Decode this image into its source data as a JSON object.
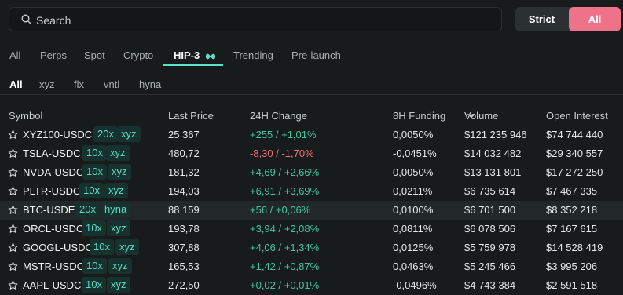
{
  "search": {
    "placeholder": "Search",
    "value": ""
  },
  "mode_toggle": {
    "strict_label": "Strict",
    "all_label": "All",
    "active_color": "#ee7388"
  },
  "category_tabs": [
    {
      "label": "All"
    },
    {
      "label": "Perps"
    },
    {
      "label": "Spot"
    },
    {
      "label": "Crypto"
    },
    {
      "label": "HIP-3",
      "active": true,
      "icon": "hyperliquid-logo-icon"
    },
    {
      "label": "Trending"
    },
    {
      "label": "Pre-launch"
    }
  ],
  "dex_tabs": [
    {
      "label": "All",
      "active": true
    },
    {
      "label": "xyz"
    },
    {
      "label": "flx"
    },
    {
      "label": "vntl"
    },
    {
      "label": "hyna"
    }
  ],
  "table": {
    "headers": {
      "symbol": "Symbol",
      "last_price": "Last Price",
      "change_24h": "24H Change",
      "funding_8h": "8H Funding",
      "volume": "Volume",
      "open_interest": "Open Interest"
    },
    "sort_icon": "chevron-down-icon",
    "rows": [
      {
        "symbol": "XYZ100-USDC",
        "leverage": "20x",
        "dex": "xyz",
        "price": "25 367",
        "change": "+255 / +1,01%",
        "funding": "0,0050%",
        "volume": "$121 235 946",
        "oi": "$74 744 440"
      },
      {
        "symbol": "TSLA-USDC",
        "leverage": "10x",
        "dex": "xyz",
        "price": "480,72",
        "change": "-8,30 / -1,70%",
        "funding": "-0,0451%",
        "volume": "$14 032 482",
        "oi": "$29 340 557"
      },
      {
        "symbol": "NVDA-USDC",
        "leverage": "10x",
        "dex": "xyz",
        "price": "181,32",
        "change": "+4,69 / +2,66%",
        "funding": "0,0050%",
        "volume": "$13 131 801",
        "oi": "$17 272 250"
      },
      {
        "symbol": "PLTR-USDC",
        "leverage": "10x",
        "dex": "xyz",
        "price": "194,03",
        "change": "+6,91 / +3,69%",
        "funding": "0,0211%",
        "volume": "$6 735 614",
        "oi": "$7 467 335"
      },
      {
        "symbol": "BTC-USDE",
        "leverage": "20x",
        "dex": "hyna",
        "price": "88 159",
        "change": "+56 / +0,06%",
        "funding": "0,0100%",
        "volume": "$6 701 500",
        "oi": "$8 352 218"
      },
      {
        "symbol": "ORCL-USDC",
        "leverage": "10x",
        "dex": "xyz",
        "price": "193,78",
        "change": "+3,94 / +2,08%",
        "funding": "0,0811%",
        "volume": "$6 078 506",
        "oi": "$7 167 615"
      },
      {
        "symbol": "GOOGL-USDC",
        "leverage": "10x",
        "dex": "xyz",
        "price": "307,88",
        "change": "+4,06 / +1,34%",
        "funding": "0,0125%",
        "volume": "$5 759 978",
        "oi": "$14 528 419"
      },
      {
        "symbol": "MSTR-USDC",
        "leverage": "10x",
        "dex": "xyz",
        "price": "165,53",
        "change": "+1,42 / +0,87%",
        "funding": "0,0463%",
        "volume": "$5 245 466",
        "oi": "$3 995 206"
      },
      {
        "symbol": "AAPL-USDC",
        "leverage": "10x",
        "dex": "xyz",
        "price": "272,50",
        "change": "+0,02 / +0,01%",
        "funding": "-0,0496%",
        "volume": "$4 743 384",
        "oi": "$2 591 518"
      }
    ]
  },
  "colors": {
    "positive": "#3fc49c",
    "negative": "#ee6d7d",
    "accent": "#5ce0c8",
    "badge_bg": "#17312e"
  }
}
